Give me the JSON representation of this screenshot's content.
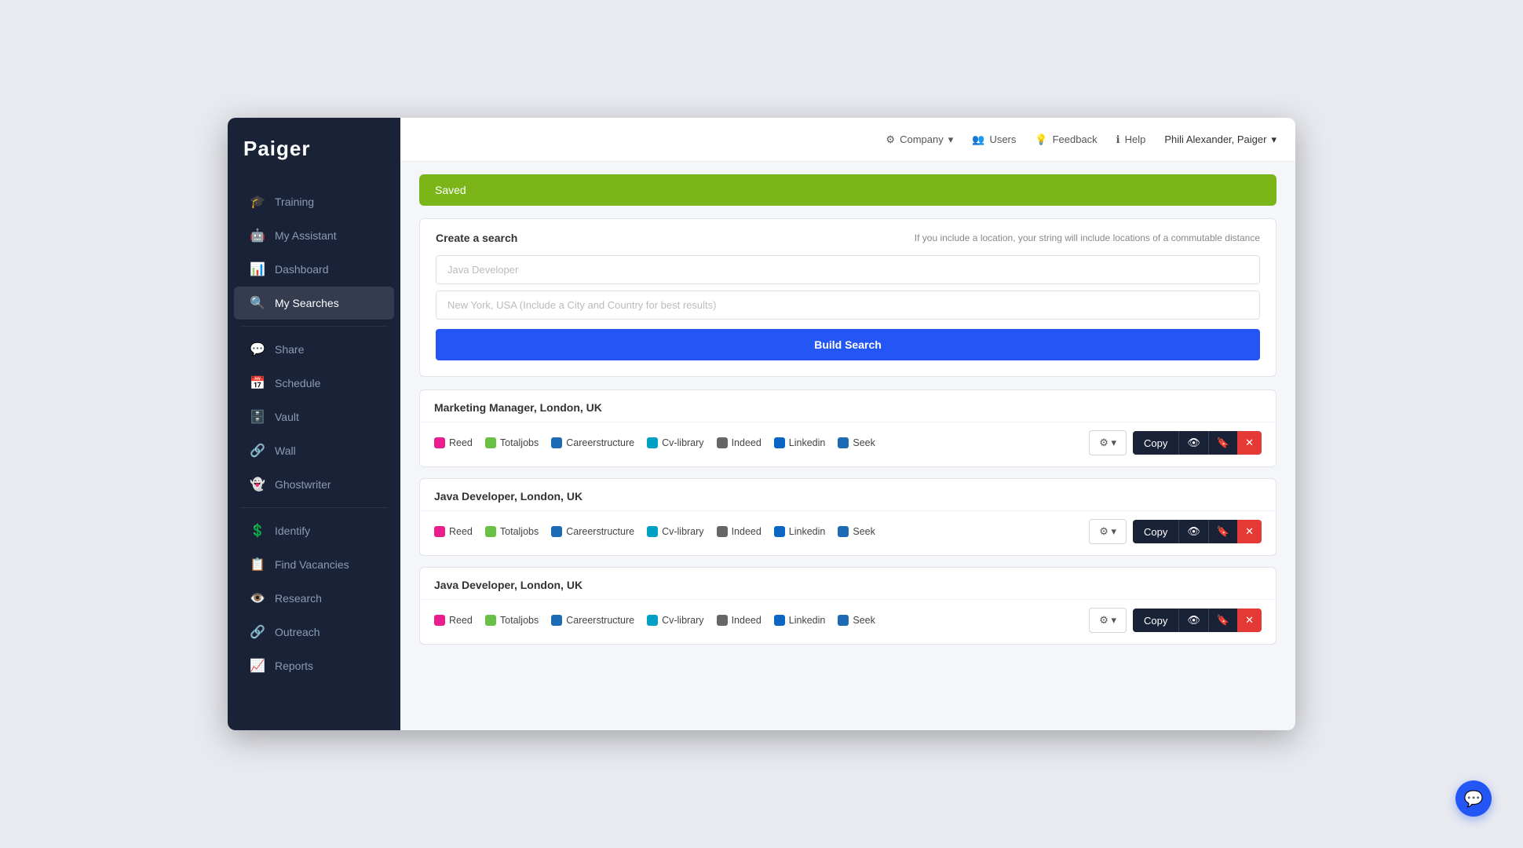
{
  "app": {
    "name": "Paiger"
  },
  "header": {
    "company_label": "Company",
    "users_label": "Users",
    "feedback_label": "Feedback",
    "help_label": "Help",
    "user_name": "Phili Alexander, Paiger"
  },
  "sidebar": {
    "items": [
      {
        "id": "training",
        "label": "Training",
        "icon": "🎓"
      },
      {
        "id": "my-assistant",
        "label": "My Assistant",
        "icon": "🤖"
      },
      {
        "id": "dashboard",
        "label": "Dashboard",
        "icon": "📊"
      },
      {
        "id": "my-searches",
        "label": "My Searches",
        "icon": "🔍",
        "active": true
      },
      {
        "id": "share",
        "label": "Share",
        "icon": "💬"
      },
      {
        "id": "schedule",
        "label": "Schedule",
        "icon": "📅"
      },
      {
        "id": "vault",
        "label": "Vault",
        "icon": "🗄️"
      },
      {
        "id": "wall",
        "label": "Wall",
        "icon": "🔗"
      },
      {
        "id": "ghostwriter",
        "label": "Ghostwriter",
        "icon": "👻"
      },
      {
        "id": "identify",
        "label": "Identify",
        "icon": "💲"
      },
      {
        "id": "find-vacancies",
        "label": "Find Vacancies",
        "icon": "📋"
      },
      {
        "id": "research",
        "label": "Research",
        "icon": "👁️"
      },
      {
        "id": "outreach",
        "label": "Outreach",
        "icon": "🔗"
      },
      {
        "id": "reports",
        "label": "Reports",
        "icon": "📈"
      }
    ]
  },
  "banner": {
    "text": "Saved"
  },
  "create_search": {
    "title": "Create a search",
    "hint": "If you include a location, your string will include locations of a commutable distance",
    "placeholder_job": "Java Developer",
    "placeholder_location": "New York, USA (Include a City and Country for best results)",
    "build_button": "Build Search"
  },
  "search_results": [
    {
      "id": 1,
      "title": "Marketing Manager, London, UK",
      "boards": [
        {
          "name": "Reed",
          "color": "#e91e8c"
        },
        {
          "name": "Totaljobs",
          "color": "#6abf45"
        },
        {
          "name": "Careerstructure",
          "color": "#1e6bb5"
        },
        {
          "name": "Cv-library",
          "color": "#00a0c6"
        },
        {
          "name": "Indeed",
          "color": "#666"
        },
        {
          "name": "Linkedin",
          "color": "#0a66c2"
        },
        {
          "name": "Seek",
          "color": "#1e6bb5"
        }
      ],
      "copy_label": "Copy",
      "gear_label": "⚙"
    },
    {
      "id": 2,
      "title": "Java Developer, London, UK",
      "boards": [
        {
          "name": "Reed",
          "color": "#e91e8c"
        },
        {
          "name": "Totaljobs",
          "color": "#6abf45"
        },
        {
          "name": "Careerstructure",
          "color": "#1e6bb5"
        },
        {
          "name": "Cv-library",
          "color": "#00a0c6"
        },
        {
          "name": "Indeed",
          "color": "#666"
        },
        {
          "name": "Linkedin",
          "color": "#0a66c2"
        },
        {
          "name": "Seek",
          "color": "#1e6bb5"
        }
      ],
      "copy_label": "Copy",
      "gear_label": "⚙"
    },
    {
      "id": 3,
      "title": "Java Developer, London, UK",
      "boards": [
        {
          "name": "Reed",
          "color": "#e91e8c"
        },
        {
          "name": "Totaljobs",
          "color": "#6abf45"
        },
        {
          "name": "Careerstructure",
          "color": "#1e6bb5"
        },
        {
          "name": "Cv-library",
          "color": "#00a0c6"
        },
        {
          "name": "Indeed",
          "color": "#666"
        },
        {
          "name": "Linkedin",
          "color": "#0a66c2"
        },
        {
          "name": "Seek",
          "color": "#1e6bb5"
        }
      ],
      "copy_label": "Copy",
      "gear_label": "⚙"
    }
  ],
  "chat_button": {
    "icon": "💬"
  }
}
